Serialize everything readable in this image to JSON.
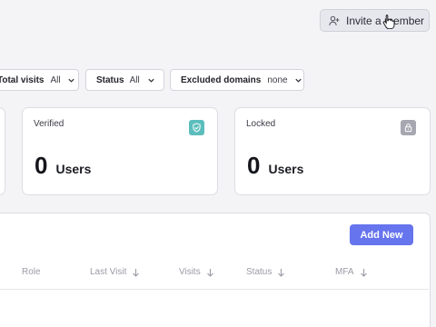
{
  "header": {
    "invite_button_label": "Invite a member"
  },
  "filters": [
    {
      "label": "Total visits",
      "value": "All"
    },
    {
      "label": "Status",
      "value": "All"
    },
    {
      "label": "Excluded domains",
      "value": "none"
    }
  ],
  "cards": [
    {
      "title": "Verified",
      "value": "0",
      "unit": "Users",
      "icon": "shield-check-icon",
      "icon_color": "#5cbdbd"
    },
    {
      "title": "Locked",
      "value": "0",
      "unit": "Users",
      "icon": "lock-icon",
      "icon_color": "#a6a7b0"
    }
  ],
  "table": {
    "add_new_label": "Add New",
    "columns": [
      "Role",
      "Last Visit",
      "Visits",
      "Status",
      "MFA"
    ]
  },
  "colors": {
    "accent": "#6674ee",
    "verified_badge": "#5cbdbd",
    "locked_badge": "#a6a7b0"
  }
}
